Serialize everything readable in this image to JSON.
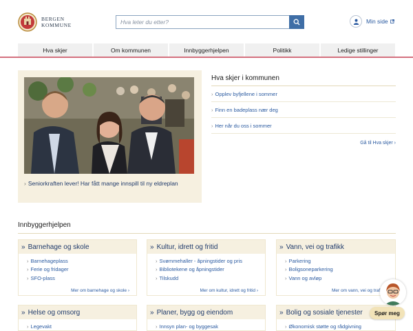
{
  "brand": {
    "line1": "BERGEN",
    "line2": "KOMMUNE",
    "accent": "#3f6ea6",
    "nav_rule": "#d4707e"
  },
  "search": {
    "placeholder": "Hva leter du etter?",
    "button_icon": "search-icon"
  },
  "mypage": {
    "label": "Min side",
    "icon": "user-icon"
  },
  "nav": [
    {
      "label": "Hva skjer"
    },
    {
      "label": "Om kommunen"
    },
    {
      "label": "Innbyggerhjelpen"
    },
    {
      "label": "Politikk"
    },
    {
      "label": "Ledige stillinger"
    }
  ],
  "feature": {
    "caption": "Seniorkraften lever! Har fått mange innspill til ny eldreplan"
  },
  "news": {
    "title": "Hva skjer i kommunen",
    "items": [
      {
        "label": "Opplev byfjellene i sommer"
      },
      {
        "label": "Finn en badeplass nær deg"
      },
      {
        "label": "Her når du oss i sommer"
      }
    ],
    "more": "Gå til Hva skjer"
  },
  "section": {
    "title": "Innbyggerhjelpen"
  },
  "cards": [
    {
      "title": "Barnehage og skole",
      "links": [
        "Barnehageplass",
        "Ferie og fridager",
        "SFO-plass"
      ],
      "more": "Mer om barnehage og skole"
    },
    {
      "title": "Kultur, idrett og fritid",
      "links": [
        "Svømmehaller - åpningstider og pris",
        "Bibliotekene og åpningstider",
        "Tilskudd"
      ],
      "more": "Mer om kultur, idrett og fritid"
    },
    {
      "title": "Vann, vei og trafikk",
      "links": [
        "Parkering",
        "Boligsoneparkering",
        "Vann og avløp"
      ],
      "more": "Mer om vann, vei og trafikk"
    },
    {
      "title": "Helse og omsorg",
      "links": [
        "Legevakt"
      ]
    },
    {
      "title": "Planer, bygg og eiendom",
      "links": [
        "Innsyn plan- og byggesak"
      ]
    },
    {
      "title": "Bolig og sosiale tjenester",
      "links": [
        "Økonomisk støtte og rådgivning"
      ]
    }
  ],
  "chat": {
    "label": "Spør meg"
  }
}
